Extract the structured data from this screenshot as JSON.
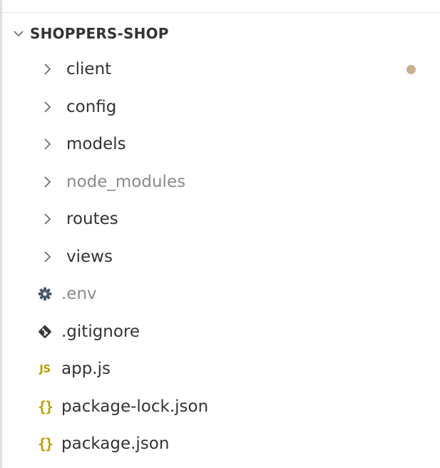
{
  "explorer": {
    "section_title": "SHOPPERS-SHOP",
    "folders": [
      {
        "label": "client",
        "modified": true,
        "ignored": false
      },
      {
        "label": "config",
        "modified": false,
        "ignored": false
      },
      {
        "label": "models",
        "modified": false,
        "ignored": false
      },
      {
        "label": "node_modules",
        "modified": false,
        "ignored": true
      },
      {
        "label": "routes",
        "modified": false,
        "ignored": false
      },
      {
        "label": "views",
        "modified": false,
        "ignored": false
      }
    ],
    "files": [
      {
        "label": ".env",
        "icon": "gear-icon",
        "ignored": true
      },
      {
        "label": ".gitignore",
        "icon": "git-icon",
        "ignored": false
      },
      {
        "label": "app.js",
        "icon": "js-file-icon",
        "badge": "JS",
        "ignored": false
      },
      {
        "label": "package-lock.json",
        "icon": "json-file-icon",
        "badge": "{}",
        "ignored": false
      },
      {
        "label": "package.json",
        "icon": "json-file-icon",
        "badge": "{}",
        "ignored": false
      }
    ]
  },
  "colors": {
    "text": "#333333",
    "ignored_text": "#8a8a8a",
    "chevron": "#555555",
    "modified_dot": "#c8b08f",
    "gear": "#4d5a66",
    "git": "#3a3a3a",
    "js": "#b8a000",
    "json": "#b8a000"
  }
}
